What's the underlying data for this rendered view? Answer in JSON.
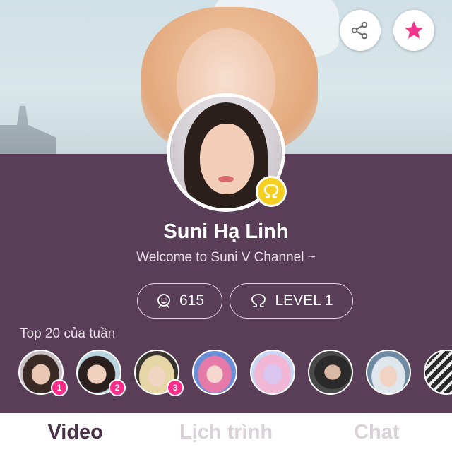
{
  "profile": {
    "name": "Suni Hạ Linh",
    "tagline": "Welcome to Suni V Channel ~",
    "fan_count": "615",
    "level": "LEVEL 1"
  },
  "fans": {
    "title": "Top 20 của tuần",
    "ranks": [
      "1",
      "2",
      "3"
    ]
  },
  "tabs": [
    {
      "label": "Video",
      "active": true
    },
    {
      "label": "Lịch trình",
      "active": false
    },
    {
      "label": "Chat",
      "active": false
    }
  ],
  "icons": {
    "share": "share-icon",
    "favorite": "star-icon",
    "fans": "fans-icon",
    "level": "level-heart-icon",
    "badge": "omega-badge-icon"
  },
  "colors": {
    "panel": "#5a3d57",
    "star": "#f0338b",
    "rank_badge": "#ff2d8a",
    "level_badge": "#f5d020",
    "tab_active": "#4a3048",
    "tab_inactive": "#d9d2d8"
  }
}
